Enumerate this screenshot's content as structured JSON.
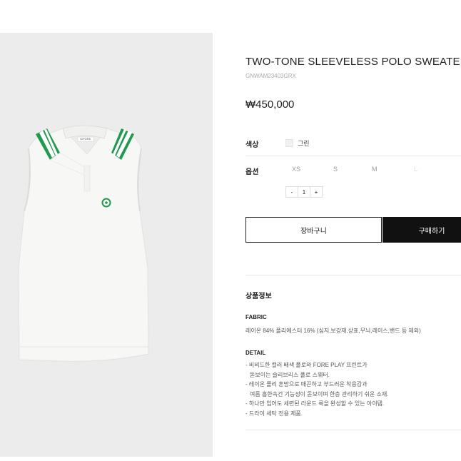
{
  "product": {
    "title": "TWO-TONE SLEEVELESS POLO SWEATER",
    "code": "GNWAM23403GRX",
    "price": "₩450,000",
    "brand_tag": "G/FORE",
    "colors": {
      "accent_green": "#1f9a4e",
      "stripe_white": "#ffffff"
    }
  },
  "options": {
    "color_label": "색상",
    "color_value": "그린",
    "size_label": "옵션",
    "sizes": [
      "XS",
      "S",
      "M",
      "L"
    ],
    "quantity": {
      "minus": "-",
      "value": "1",
      "plus": "+"
    }
  },
  "actions": {
    "cart_label": "장바구니",
    "buy_label": "구매하기"
  },
  "info": {
    "section_title": "상품정보",
    "fabric_title": "FABRIC",
    "fabric_text": "레이온 84% 폴리에스터 16% (심지,보강재,상표,무늬,레이스,밴드 등 제외)",
    "detail_title": "DETAIL",
    "detail_lines": [
      "- 비비드한 컬러 배색 폴로와 FORE PLAY 프린트가",
      "  돋보이는 슬리브리스 폴로 스웨터.",
      "- 레이온 폴리 혼방으로 매끈하고 부드러운 착용감과",
      "  여름 흡한속건 기능성이 돋보이며 한층 관리하기 쉬운 소재.",
      "- 하나만 입어도 세련된 라운드 룩을 완성할 수 있는 아이템.",
      "- 드라이 세탁 전용 제품."
    ]
  }
}
